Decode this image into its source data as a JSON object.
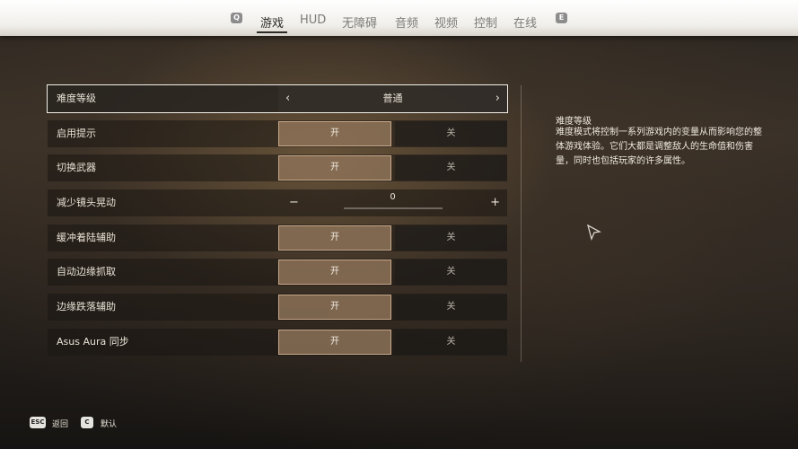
{
  "tabs": {
    "left_key": "Q",
    "right_key": "E",
    "items": [
      {
        "label": "游戏"
      },
      {
        "label": "HUD"
      },
      {
        "label": "无障碍"
      },
      {
        "label": "音频"
      },
      {
        "label": "视频"
      },
      {
        "label": "控制"
      },
      {
        "label": "在线"
      }
    ],
    "active": "游戏"
  },
  "settings": {
    "difficulty": {
      "label": "难度等级",
      "value": "普通"
    },
    "hints": {
      "label": "启用提示",
      "on": "开",
      "off": "关",
      "selected": "on"
    },
    "switch_weapon": {
      "label": "切换武器",
      "on": "开",
      "off": "关",
      "selected": "on"
    },
    "camera_shake": {
      "label": "减少镜头晃动",
      "value": "0",
      "minus": "−",
      "plus": "+"
    },
    "landing_assist": {
      "label": "缓冲着陆辅助",
      "on": "开",
      "off": "关",
      "selected": "on"
    },
    "ledge_grab": {
      "label": "自动边缘抓取",
      "on": "开",
      "off": "关",
      "selected": "on"
    },
    "ledge_fall": {
      "label": "边缘跌落辅助",
      "on": "开",
      "off": "关",
      "selected": "on"
    },
    "asus_aura": {
      "label": "Asus Aura 同步",
      "on": "开",
      "off": "关",
      "selected": "on"
    }
  },
  "description": {
    "title": "难度等级",
    "body": "难度模式将控制一系列游戏内的变量从而影响您的整体游戏体验。它们大都是调整敌人的生命值和伤害量，同时也包括玩家的许多属性。"
  },
  "footer": {
    "back_key": "ESC",
    "back_label": "返回",
    "default_key": "C",
    "default_label": "默认"
  },
  "colors": {
    "topbar": "#f1efeb",
    "selected_option": "#ac8c6c",
    "text": "#e8e2d6"
  }
}
